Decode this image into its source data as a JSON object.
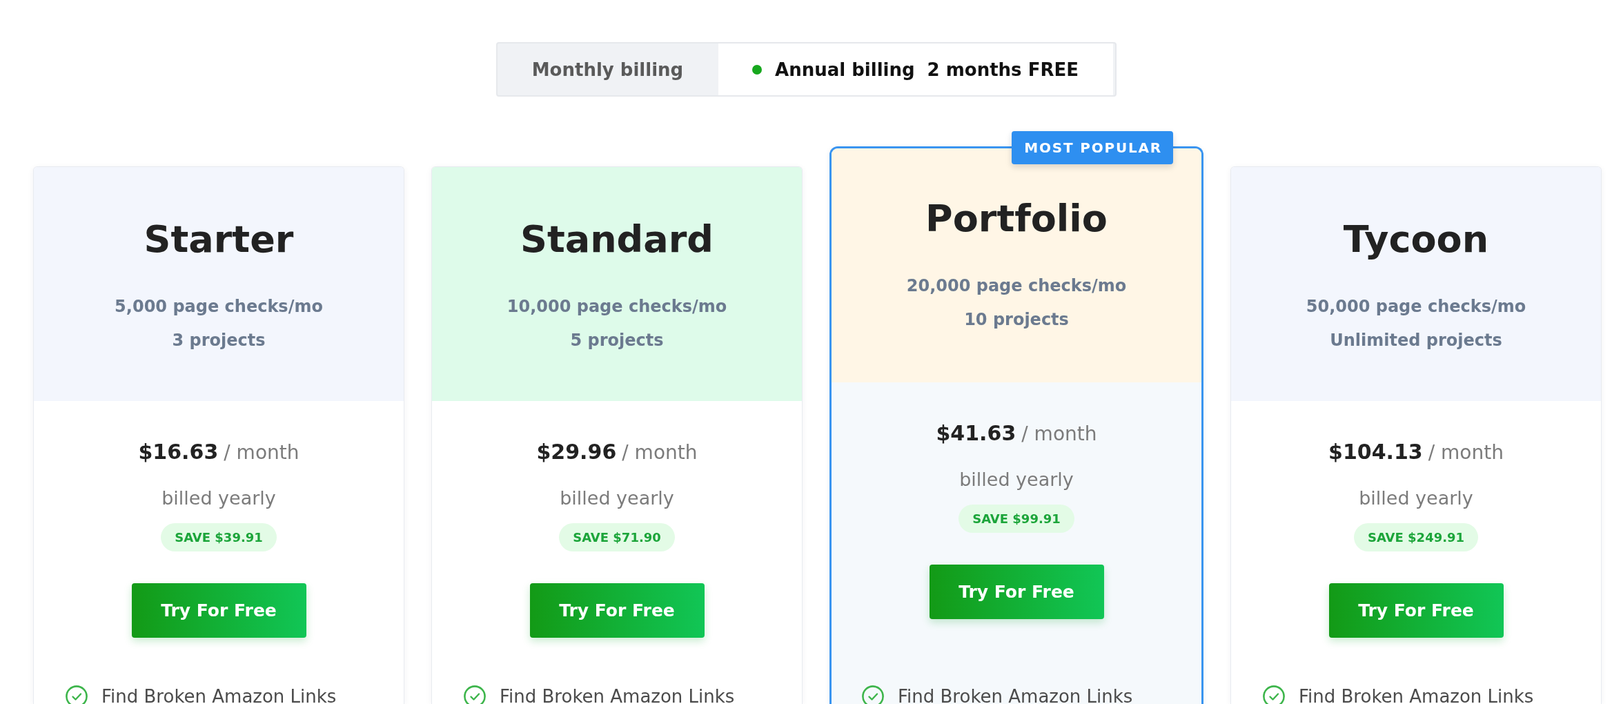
{
  "billing_toggle": {
    "options": [
      {
        "label": "Monthly billing",
        "selected": false
      },
      {
        "label": "Annual billing",
        "note": "2 months FREE",
        "selected": true
      }
    ]
  },
  "plans": [
    {
      "name": "Starter",
      "color": "#f3f6fd",
      "featured": false,
      "page_checks": "5,000 page checks/mo",
      "projects": "3 projects",
      "price": "$16.63",
      "period": "/ month",
      "billing": "billed yearly",
      "savings": "SAVE $39.91",
      "button": "Try For Free",
      "features": [
        "Find Broken Amazon Links"
      ]
    },
    {
      "name": "Standard",
      "color": "#defbea",
      "featured": false,
      "page_checks": "10,000 page checks/mo",
      "projects": "5 projects",
      "price": "$29.96",
      "period": "/ month",
      "billing": "billed yearly",
      "savings": "SAVE $71.90",
      "button": "Try For Free",
      "features": [
        "Find Broken Amazon Links"
      ]
    },
    {
      "name": "Portfolio",
      "color": "#fff6e6",
      "featured": true,
      "badge": "MOST POPULAR",
      "page_checks": "20,000 page checks/mo",
      "projects": "10 projects",
      "price": "$41.63",
      "period": "/ month",
      "billing": "billed yearly",
      "savings": "SAVE $99.91",
      "button": "Try For Free",
      "features": [
        "Find Broken Amazon Links"
      ]
    },
    {
      "name": "Tycoon",
      "color": "#f3f6fd",
      "featured": false,
      "page_checks": "50,000 page checks/mo",
      "projects": "Unlimited projects",
      "price": "$104.13",
      "period": "/ month",
      "billing": "billed yearly",
      "savings": "SAVE $249.91",
      "button": "Try For Free",
      "features": [
        "Find Broken Amazon Links"
      ]
    }
  ]
}
